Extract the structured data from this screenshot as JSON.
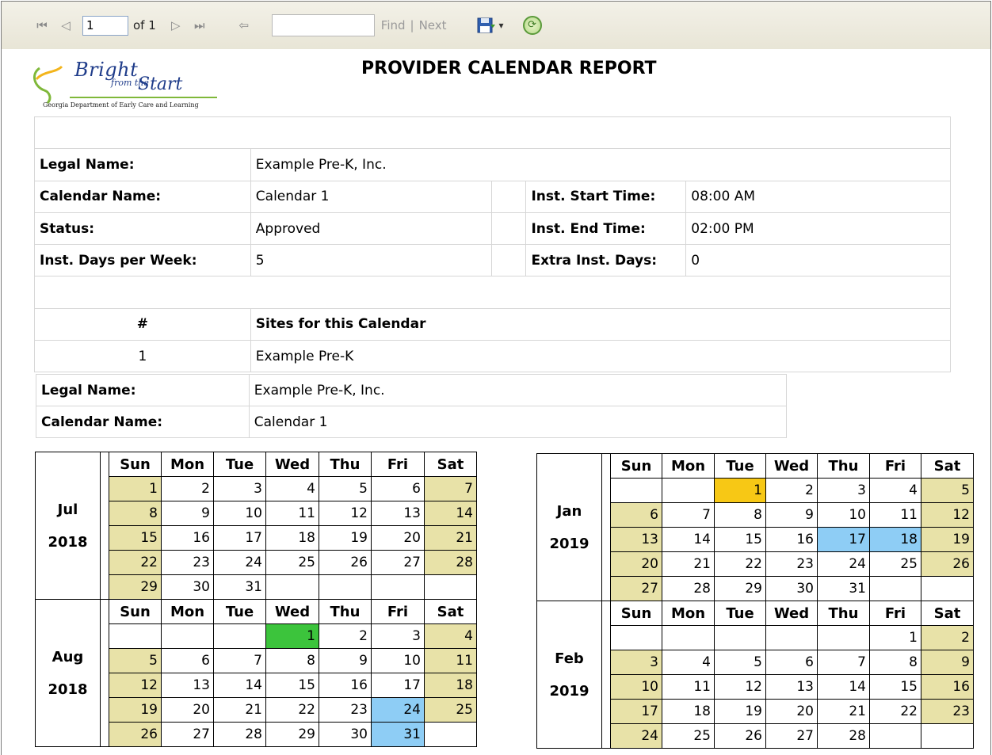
{
  "toolbar": {
    "first_page": "⏮",
    "prev_page": "◁",
    "page_number": "1",
    "of_pages": "of 1",
    "next_page": "▷",
    "last_page": "⏭",
    "back": "⇦",
    "find_value": "",
    "find_label": "Find",
    "separator": "|",
    "next_label": "Next",
    "save_arrow": "▾"
  },
  "logo": {
    "brand_bright": "Bright",
    "brand_from": "from the",
    "brand_start": "Start",
    "subtitle": "Georgia Department of Early Care and Learning"
  },
  "page_title": "PROVIDER CALENDAR REPORT",
  "info": {
    "legal_name_label": "Legal Name:",
    "legal_name": "Example Pre-K, Inc.",
    "calendar_name_label": "Calendar Name:",
    "calendar_name": "Calendar 1",
    "inst_start_label": "Inst. Start Time:",
    "inst_start": "08:00 AM",
    "status_label": "Status:",
    "status": "Approved",
    "inst_end_label": "Inst. End Time:",
    "inst_end": "02:00 PM",
    "days_per_week_label": "Inst. Days per Week:",
    "days_per_week": "5",
    "extra_days_label": "Extra Inst. Days:",
    "extra_days": "0",
    "sites_num_header": "#",
    "sites_header": "Sites for this Calendar",
    "site_num": "1",
    "site_name": "Example Pre-K"
  },
  "info2": {
    "legal_name_label": "Legal Name:",
    "legal_name": "Example Pre-K, Inc.",
    "calendar_name_label": "Calendar Name:",
    "calendar_name": "Calendar 1"
  },
  "weekdays": [
    "Sun",
    "Mon",
    "Tue",
    "Wed",
    "Thu",
    "Fri",
    "Sat"
  ],
  "calendars": {
    "jul": {
      "month": "Jul",
      "year": "2018"
    },
    "aug": {
      "month": "Aug",
      "year": "2018"
    },
    "jan": {
      "month": "Jan",
      "year": "2019"
    },
    "feb": {
      "month": "Feb",
      "year": "2019"
    }
  },
  "legend_colors": {
    "weekend": "#e8e2a8",
    "green": "#3cc43c",
    "blue": "#8ecdf5",
    "yellow": "#f7c815"
  }
}
